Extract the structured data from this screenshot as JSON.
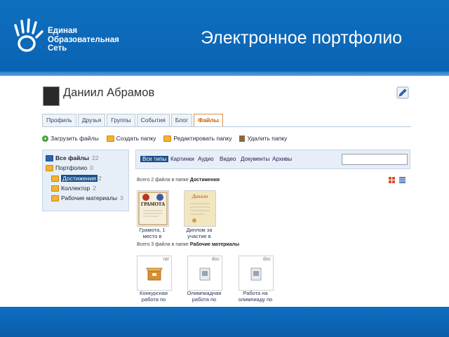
{
  "banner": {
    "logo_lines": [
      "Единая",
      "Образовательная",
      "Сеть"
    ],
    "title": "Электронное портфолио"
  },
  "profile": {
    "name": "Даниил Абрамов"
  },
  "tabs": [
    {
      "label": "Профиль"
    },
    {
      "label": "Друзья"
    },
    {
      "label": "Группы"
    },
    {
      "label": "События"
    },
    {
      "label": "Блог"
    },
    {
      "label": "Файлы",
      "active": true
    }
  ],
  "actions": [
    {
      "label": "Загрузить файлы",
      "icon": "plus-icon"
    },
    {
      "label": "Создать папку",
      "icon": "folder-icon"
    },
    {
      "label": "Редактировать папку",
      "icon": "folder-icon"
    },
    {
      "label": "Удалить папку",
      "icon": "delete-icon"
    }
  ],
  "sidebar": {
    "items": [
      {
        "label": "Все файлы",
        "count": "22"
      },
      {
        "label": "Портфолио",
        "count": "0"
      },
      {
        "label": "Достижения",
        "count": "2",
        "selected": true
      },
      {
        "label": "Коллектор",
        "count": "2"
      },
      {
        "label": "Рабочие материалы",
        "count": "3"
      }
    ]
  },
  "filters": [
    "Все типы",
    "Картинки",
    "Аудио",
    "Видео",
    "Документы",
    "Архивы"
  ],
  "search": {
    "placeholder": ""
  },
  "sections": [
    {
      "caption_prefix": "Всего 2 файла в папке",
      "folder": "Достижения",
      "files": [
        {
          "label_line1": "Грамота, 1",
          "label_line2": "место в",
          "thumb_text": "ГРАМОТА"
        },
        {
          "label_line1": "Диплом за",
          "label_line2": "участие в",
          "thumb_text": "Диплом"
        }
      ]
    },
    {
      "caption_prefix": "Всего 3 файла в папке",
      "folder": "Рабочие материалы",
      "files": [
        {
          "ext": "rar",
          "label_line1": "Конкурсная",
          "label_line2": "работа по"
        },
        {
          "ext": "doc",
          "label_line1": "Олимпиадная",
          "label_line2": "работа по"
        },
        {
          "ext": "doc",
          "label_line1": "Работа на",
          "label_line2": "олимпиаду по"
        }
      ]
    }
  ],
  "colors": {
    "banner": "#0a63b3",
    "accent": "#1b4f8a",
    "active_tab": "#c06000"
  }
}
